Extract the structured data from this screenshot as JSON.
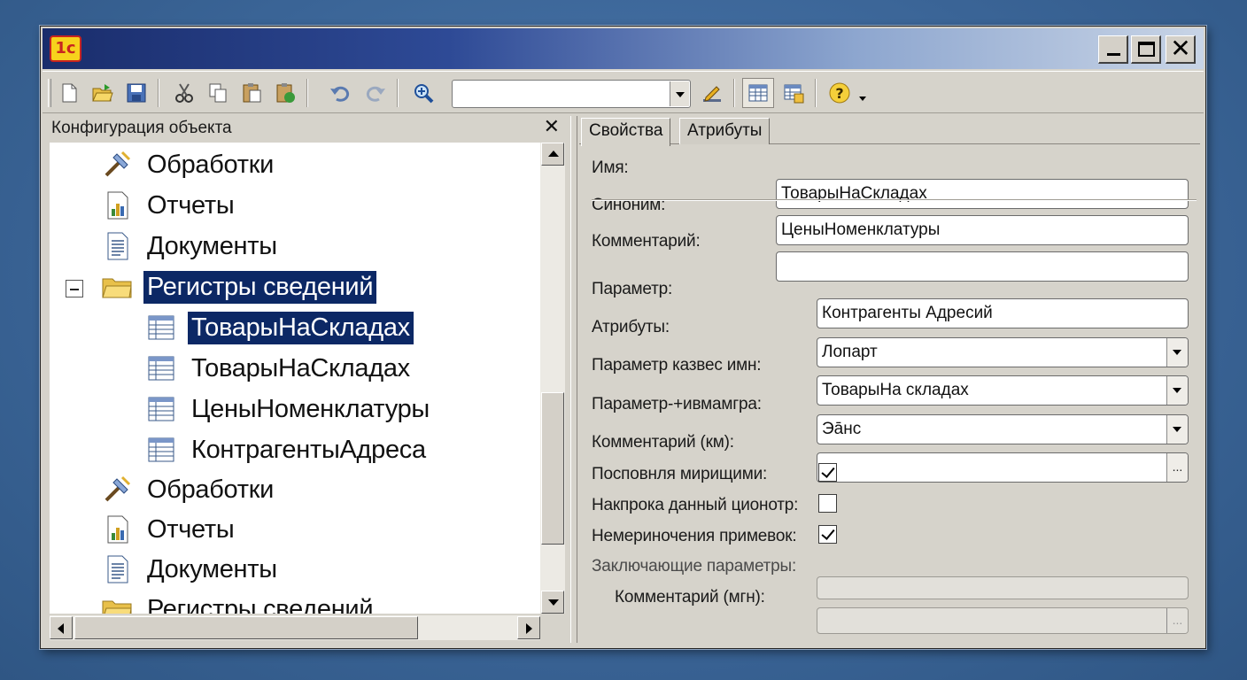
{
  "window": {
    "logo_text": "1с"
  },
  "toolbar": {
    "combo_value": "",
    "buttons": [
      "new-document-icon",
      "open-folder-icon",
      "save-icon",
      "cut-icon",
      "copy-icon",
      "paste-icon",
      "paste-special-icon",
      "undo-icon",
      "redo-icon",
      "find-icon",
      "edit-pencil-icon",
      "table-view-icon",
      "table-properties-icon",
      "help-icon"
    ]
  },
  "left_panel": {
    "title": "Конфигурация объекта",
    "close_glyph": "✕",
    "tree": [
      {
        "label": "Обработки",
        "icon": "data-processor-icon",
        "level": 0,
        "selected": false
      },
      {
        "label": "Отчеты",
        "icon": "report-icon",
        "level": 0,
        "selected": false
      },
      {
        "label": "Документы",
        "icon": "document-icon",
        "level": 0,
        "selected": false
      },
      {
        "label": "Регистры сведений",
        "icon": "folder-icon",
        "level": 0,
        "selected": true,
        "expanded": true
      },
      {
        "label": "ТоварыНаСкладах",
        "icon": "register-icon",
        "level": 1,
        "selected": true
      },
      {
        "label": "ТоварыНаСкладах",
        "icon": "register-icon",
        "level": 1,
        "selected": false
      },
      {
        "label": "ЦеныНоменклатуры",
        "icon": "register-icon",
        "level": 1,
        "selected": false
      },
      {
        "label": "КонтрагентыАдреса",
        "icon": "register-icon",
        "level": 1,
        "selected": false
      },
      {
        "label": "Обработки",
        "icon": "data-processor-icon",
        "level": 0,
        "selected": false
      },
      {
        "label": "Отчеты",
        "icon": "report-icon",
        "level": 0,
        "selected": false
      },
      {
        "label": "Документы",
        "icon": "document-icon",
        "level": 0,
        "selected": false
      },
      {
        "label": "Регистры сведений",
        "icon": "folder-icon",
        "level": 0,
        "selected": false
      }
    ]
  },
  "right_panel": {
    "tabs": [
      {
        "label": "Свойства",
        "active": true
      },
      {
        "label": "Атрибуты",
        "active": false
      }
    ],
    "top_fields": [
      {
        "label": "Имя:",
        "value": "ТоварыНаСкладах"
      },
      {
        "label": "Синоним:",
        "value": "ЦеныНоменклатуры"
      },
      {
        "label": "Комментарий:",
        "value": ""
      }
    ],
    "params": [
      {
        "label": "Параметр:",
        "value": "Контрагенты Адресий",
        "kind": "text"
      },
      {
        "label": "Атрибуты:",
        "value": "Лопарт",
        "kind": "select"
      },
      {
        "label": "Параметр казвес имн:",
        "value": "ТоварыНа складах",
        "kind": "select"
      },
      {
        "label": "Параметр-+ивмамгра:",
        "value": "Эāнс",
        "kind": "select"
      },
      {
        "label": "Комментарий (км):",
        "value": "",
        "kind": "ellipsis",
        "button": "..."
      }
    ],
    "checks": [
      {
        "label": "Посповнля мирищими:",
        "checked": true
      },
      {
        "label": "Накпрока данный ционотр:",
        "checked": false
      },
      {
        "label": "Немериночения примевок:",
        "checked": true
      }
    ],
    "disabled_fields": [
      {
        "label": "Заключающие параметры:",
        "value": ""
      },
      {
        "label": "Комментарий (мгн):",
        "value": "",
        "button": "..."
      }
    ]
  }
}
